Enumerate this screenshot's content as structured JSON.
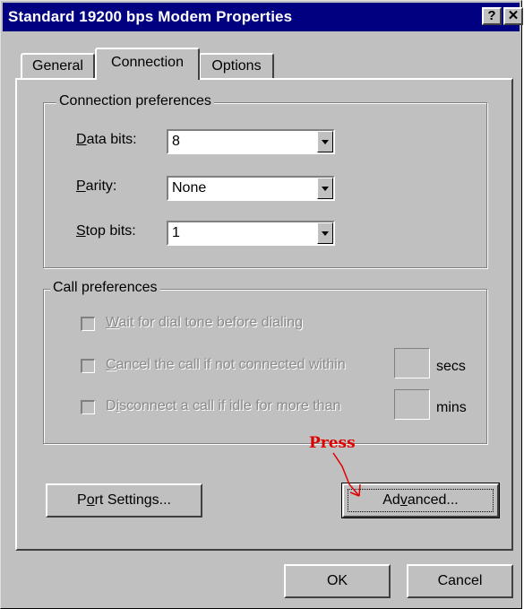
{
  "window": {
    "title": "Standard 19200 bps Modem Properties",
    "help_glyph": "?",
    "close_glyph": "✕"
  },
  "tabs": [
    {
      "label": "General",
      "active": false
    },
    {
      "label": "Connection",
      "active": true
    },
    {
      "label": "Options",
      "active": false
    }
  ],
  "connection_preferences": {
    "title": "Connection preferences",
    "data_bits": {
      "label_prefix": "D",
      "label_rest": "ata bits:",
      "value": "8"
    },
    "parity": {
      "label_prefix": "P",
      "label_rest": "arity:",
      "value": "None"
    },
    "stop_bits": {
      "label_prefix": "S",
      "label_rest": "top bits:",
      "value": "1"
    }
  },
  "call_preferences": {
    "title": "Call preferences",
    "wait_dial_tone": {
      "hotkey": "W",
      "rest": "ait for dial tone before dialing",
      "checked": false
    },
    "cancel_call": {
      "hotkey": "C",
      "rest": "ancel the call if not connected within",
      "unit": "secs",
      "checked": false
    },
    "disconnect_idle": {
      "pre": "D",
      "hotkey": "i",
      "rest": "sconnect a call if idle for more than",
      "unit": "mins",
      "checked": false
    }
  },
  "buttons": {
    "port_settings": {
      "pre": "P",
      "hotkey": "o",
      "rest": "rt Settings..."
    },
    "advanced": {
      "pre": "Ad",
      "hotkey": "v",
      "rest": "anced..."
    },
    "ok": "OK",
    "cancel": "Cancel"
  },
  "annotation": {
    "text": "Press",
    "color": "#e00000"
  },
  "colors": {
    "titlebar": "#000080",
    "face": "#c0c0c0"
  }
}
